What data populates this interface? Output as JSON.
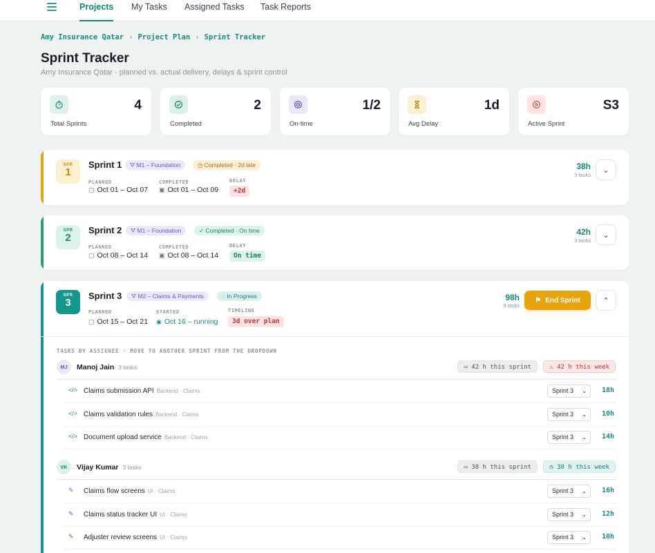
{
  "nav": {
    "tabs": [
      {
        "label": "Projects",
        "active": true
      },
      {
        "label": "My Tasks",
        "active": false
      },
      {
        "label": "Assigned Tasks",
        "active": false
      },
      {
        "label": "Task Reports",
        "active": false
      }
    ]
  },
  "breadcrumb": [
    "Amy Insurance Qatar",
    "Project Plan",
    "Sprint Tracker"
  ],
  "page": {
    "title": "Sprint Tracker",
    "subtitle": "Amy Insurance Qatar · planned vs. actual delivery, delays & sprint control"
  },
  "stats": [
    {
      "label": "Total Sprints",
      "value": "4",
      "icon": "stopwatch-icon",
      "color": "#1a8a80"
    },
    {
      "label": "Completed",
      "value": "2",
      "icon": "check-circle-icon",
      "color": "#1f8355"
    },
    {
      "label": "On-time",
      "value": "1/2",
      "icon": "target-icon",
      "color": "#6a55d0"
    },
    {
      "label": "Avg Delay",
      "value": "1d",
      "icon": "hourglass-icon",
      "color": "#b9800c"
    },
    {
      "label": "Active Sprint",
      "value": "S3",
      "icon": "play-circle-icon",
      "color": "#d9534f"
    }
  ],
  "sprints": [
    {
      "badge_prefix": "SPR",
      "number": "1",
      "name": "Sprint 1",
      "milestone": "M1 – Foundation",
      "status": "Completed · 2d late",
      "planned_caption": "PLANNED",
      "planned": "Oct 01 – Oct 07",
      "second_caption": "COMPLETED",
      "second_value": "Oct 01 – Oct 09",
      "third_caption": "DELAY",
      "third_value": "+2d",
      "hours": "38h",
      "tasks": "3 tasks",
      "accent": "#e8a40c"
    },
    {
      "badge_prefix": "SPR",
      "number": "2",
      "name": "Sprint 2",
      "milestone": "M1 – Foundation",
      "status": "Completed · On time",
      "planned_caption": "PLANNED",
      "planned": "Oct 08 – Oct 14",
      "second_caption": "COMPLETED",
      "second_value": "Oct 08 – Oct 14",
      "third_caption": "DELAY",
      "third_value": "On time",
      "hours": "42h",
      "tasks": "3 tasks",
      "accent": "#22a36b"
    },
    {
      "badge_prefix": "SPR",
      "number": "3",
      "name": "Sprint 3",
      "milestone": "M2 – Claims & Payments",
      "status": "In Progress",
      "planned_caption": "PLANNED",
      "planned": "Oct 15 – Oct 21",
      "second_caption": "STARTED",
      "second_value": "Oct 16 – running",
      "third_caption": "TIMELINE",
      "third_value": "3d over plan",
      "hours": "98h",
      "tasks": "9 tasks",
      "accent": "#14978c",
      "end_button": "End Sprint",
      "section_caption": "TASKS BY ASSIGNEE · MOVE TO ANOTHER SPRINT FROM THE DROPDOWN",
      "assignees": [
        {
          "initials": "MJ",
          "name": "Manoj Jain",
          "count": "3 tasks",
          "sprint_hours": "42 h this sprint",
          "week_hours": "42 h this week",
          "tasks": [
            {
              "name": "Claims submission API",
              "meta": "Backend · Claims",
              "sprint": "Sprint 3",
              "hours": "18h"
            },
            {
              "name": "Claims validation rules",
              "meta": "Backend · Claims",
              "sprint": "Sprint 3",
              "hours": "10h"
            },
            {
              "name": "Document upload service",
              "meta": "Backend · Claims",
              "sprint": "Sprint 3",
              "hours": "14h"
            }
          ]
        },
        {
          "initials": "VK",
          "name": "Vijay Kumar",
          "count": "3 tasks",
          "sprint_hours": "38 h this sprint",
          "week_hours": "38 h this week",
          "tasks": [
            {
              "name": "Claims flow screens",
              "meta": "UI · Claims",
              "sprint": "Sprint 3",
              "hours": "16h"
            },
            {
              "name": "Claims status tracker UI",
              "meta": "UI · Claims",
              "sprint": "Sprint 3",
              "hours": "12h"
            },
            {
              "name": "Adjuster review screens",
              "meta": "UI · Claims",
              "sprint": "Sprint 3",
              "hours": "10h"
            }
          ]
        }
      ]
    }
  ]
}
